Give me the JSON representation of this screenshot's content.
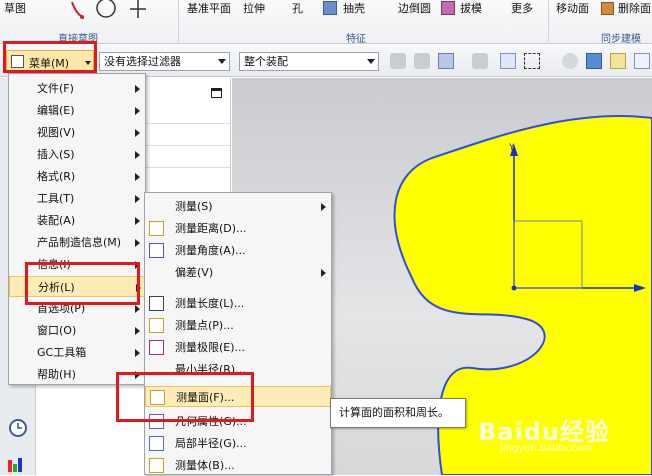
{
  "ribbon": {
    "items": [
      "草图",
      "基准平面",
      "拉伸",
      "孔",
      "抽壳",
      "边倒圆",
      "拔模",
      "更多",
      "移动面",
      "删除面"
    ],
    "groups": [
      "直接草图",
      "特征",
      "同步建模"
    ]
  },
  "toolbar": {
    "menu_button": "菜单(M)",
    "filter_value": "没有选择过滤器",
    "assembly_value": "整个装配"
  },
  "main_menu": {
    "items": [
      {
        "label": "文件(F)",
        "sub": true
      },
      {
        "label": "编辑(E)",
        "sub": true
      },
      {
        "label": "视图(V)",
        "sub": true
      },
      {
        "label": "插入(S)",
        "sub": true
      },
      {
        "label": "格式(R)",
        "sub": true
      },
      {
        "label": "工具(T)",
        "sub": true
      },
      {
        "label": "装配(A)",
        "sub": true
      },
      {
        "label": "产品制造信息(M)",
        "sub": true
      },
      {
        "label": "信息(I)",
        "sub": true
      },
      {
        "label": "分析(L)",
        "sub": true
      },
      {
        "label": "首选项(P)",
        "sub": true
      },
      {
        "label": "窗口(O)",
        "sub": true
      },
      {
        "label": "GC工具箱",
        "sub": true
      },
      {
        "label": "帮助(H)",
        "sub": true
      }
    ]
  },
  "analysis_menu": {
    "items": [
      {
        "label": "测量(S)",
        "sub": true,
        "icon": "none"
      },
      {
        "label": "测量距离(D)...",
        "sub": false,
        "icon": "ruler-distance-icon"
      },
      {
        "label": "测量角度(A)...",
        "sub": false,
        "icon": "angle-icon"
      },
      {
        "label": "偏差(V)",
        "sub": true,
        "icon": "none"
      },
      {
        "label": "测量长度(L)...",
        "sub": false,
        "icon": "arc-length-icon"
      },
      {
        "label": "测量点(P)...",
        "sub": false,
        "icon": "ruler-point-icon"
      },
      {
        "label": "测量极限(E)...",
        "sub": false,
        "icon": "limit-icon"
      },
      {
        "label": "最小半径(R)...",
        "sub": false,
        "icon": "none"
      },
      {
        "label": "测量面(F)...",
        "sub": false,
        "icon": "measure-face-icon"
      },
      {
        "label": "几何属性(G)...",
        "sub": false,
        "icon": "geometry-icon"
      },
      {
        "label": "局部半径(G)...",
        "sub": false,
        "icon": "local-radius-icon"
      },
      {
        "label": "测量体(B)...",
        "sub": false,
        "icon": "measure-body-icon"
      }
    ]
  },
  "tooltip": "计算面的面积和周长。",
  "watermark": {
    "brand": "Baidu经验",
    "url": "jingyan.baidu.com"
  },
  "colors": {
    "shape_fill": "#ffff00",
    "shape_edge": "#2f4fd6",
    "highlight": "#e0191f",
    "menu_hover": "#fdecb5"
  }
}
